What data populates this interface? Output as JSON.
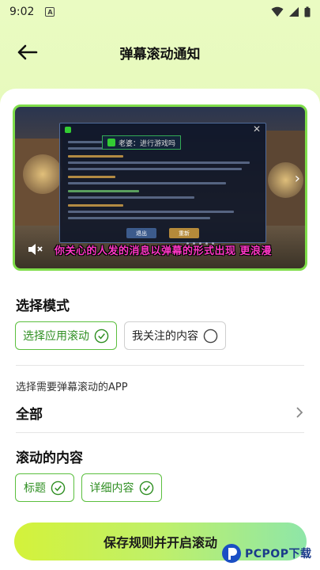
{
  "status_bar": {
    "time": "9:02",
    "a_badge": "A"
  },
  "header": {
    "title": "弹幕滚动通知",
    "back_icon": "arrow-left-icon"
  },
  "preview": {
    "subtitle": "你关心的人发的消息以弹幕的形式出现 更浪漫",
    "notice_text": "老婆：进行游戏吗",
    "dialog_buttons": [
      "退出",
      "重新"
    ],
    "colors": {
      "border": "#7fdd4a",
      "subtitle": "#ff37c6"
    }
  },
  "mode": {
    "title": "选择模式",
    "options": [
      {
        "label": "选择应用滚动",
        "selected": true
      },
      {
        "label": "我关注的内容",
        "selected": false
      }
    ]
  },
  "app_select": {
    "label": "选择需要弹幕滚动的APP",
    "value": "全部"
  },
  "content": {
    "title": "滚动的内容",
    "options": [
      {
        "label": "标题",
        "selected": true
      },
      {
        "label": "详细内容",
        "selected": true
      }
    ]
  },
  "save_button": {
    "label": "保存规则并开启滚动"
  },
  "watermark": {
    "text": "PCPOP下载"
  },
  "colors": {
    "accent_green": "#5bbf3e",
    "background": "#e3f9b6"
  }
}
